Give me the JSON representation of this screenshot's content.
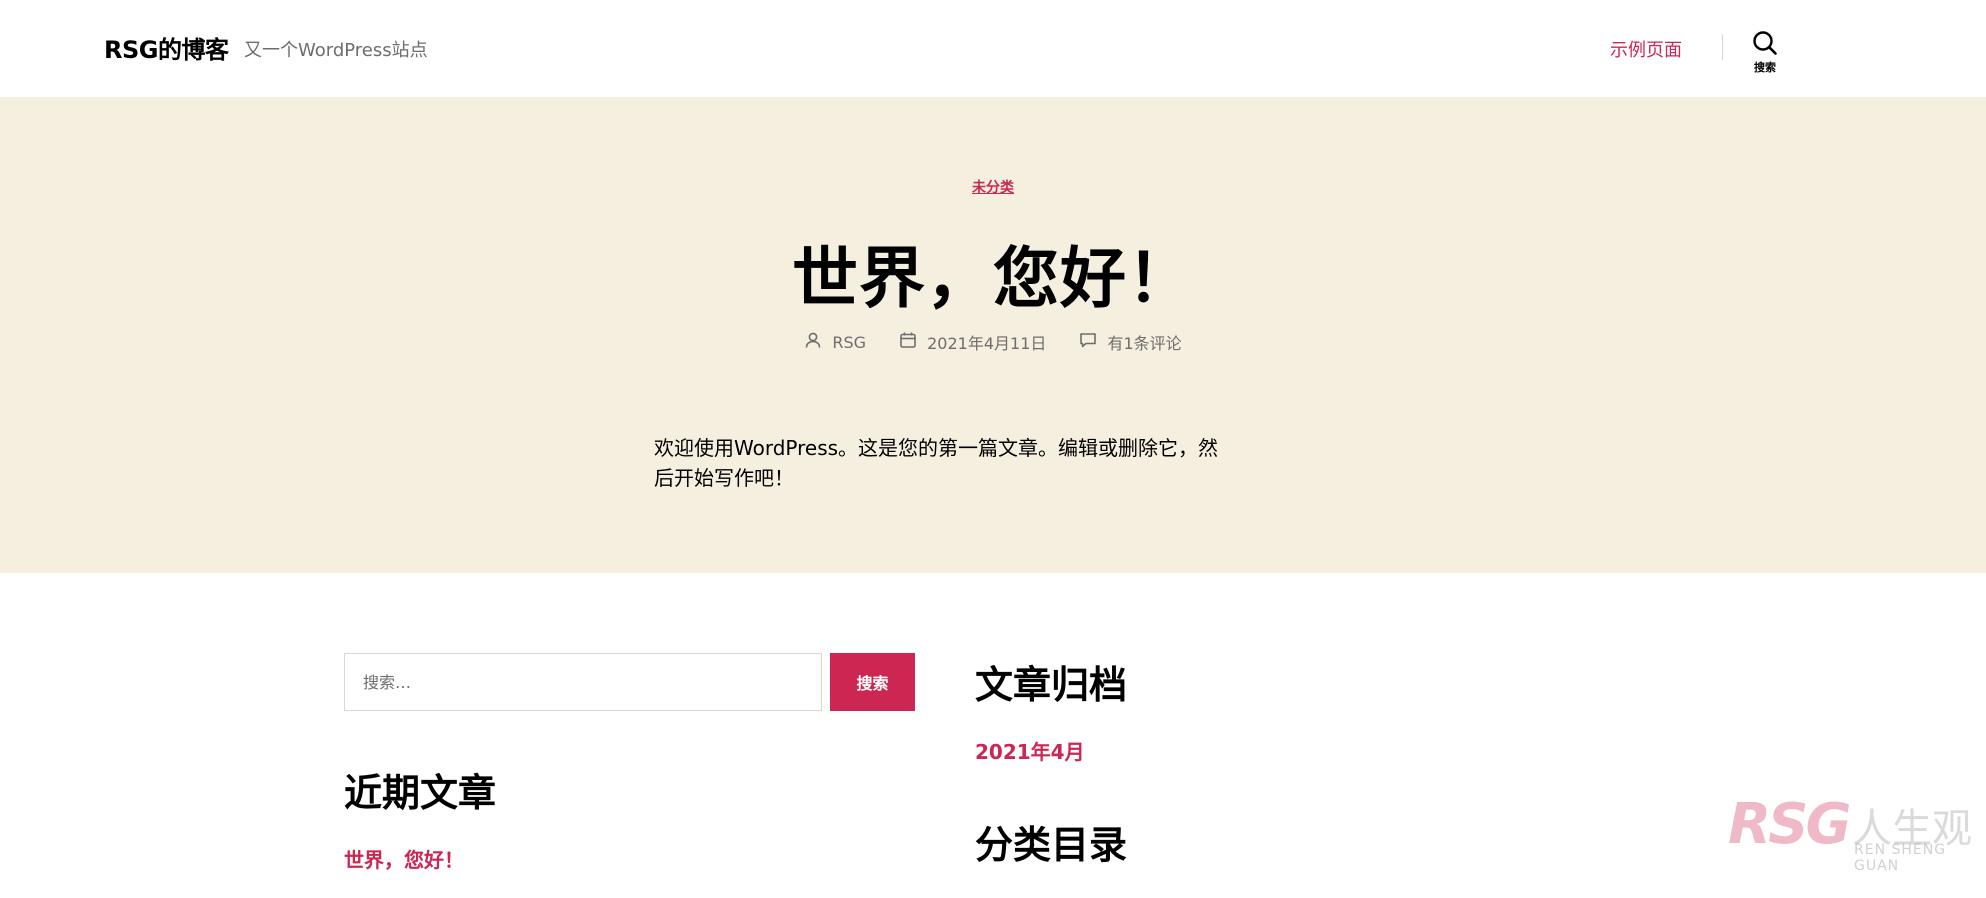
{
  "header": {
    "site_title": "RSG的博客",
    "site_description": "又一个WordPress站点",
    "nav_link": "示例页面",
    "search_toggle_label": "搜索"
  },
  "post": {
    "category": "未分类",
    "title": "世界，您好！",
    "meta": {
      "author": "RSG",
      "date": "2021年4月11日",
      "comments": "有1条评论"
    },
    "excerpt": "欢迎使用WordPress。这是您的第一篇文章。编辑或删除它，然后开始写作吧！"
  },
  "widgets": {
    "search": {
      "placeholder": "搜索…",
      "button_label": "搜索"
    },
    "recent_posts": {
      "title": "近期文章",
      "items": [
        "世界，您好！"
      ]
    },
    "archives": {
      "title": "文章归档",
      "items": [
        "2021年4月"
      ]
    },
    "categories": {
      "title": "分类目录"
    }
  },
  "watermark": {
    "brand": "RSG",
    "chinese": "人生观",
    "english": "REN SHENG GUAN"
  },
  "colors": {
    "accent": "#cd2653",
    "hero_background": "#f5efe0",
    "secondary_text": "#6d6d6d"
  }
}
